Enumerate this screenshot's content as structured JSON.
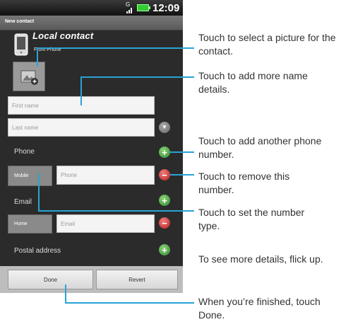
{
  "status_bar": {
    "network": "G",
    "time": "12:09"
  },
  "title_bar": {
    "title": "New contact"
  },
  "account": {
    "title": "Local contact",
    "subtitle": "From Phone",
    "icon": "phone-icon"
  },
  "photo": {
    "icon": "add-picture-icon"
  },
  "name": {
    "first_placeholder": "First name",
    "last_placeholder": "Last name"
  },
  "phone": {
    "label": "Phone",
    "type": "Mobile",
    "placeholder": "Phone"
  },
  "email": {
    "label": "Email",
    "type": "Home",
    "placeholder": "Email"
  },
  "postal": {
    "label": "Postal address"
  },
  "buttons": {
    "done": "Done",
    "revert": "Revert"
  },
  "callouts": {
    "picture": "Touch to select a picture for the contact.",
    "name_details": "Touch to add more name details.",
    "add_phone": "Touch to add another phone number.",
    "remove": "Touch to remove this number.",
    "set_type": "Touch to set the number type.",
    "more_details": "To see more details, flick up.",
    "finished_prefix": "When you’re finished, touch ",
    "finished_done": "Done",
    "finished_suffix": "."
  },
  "colors": {
    "callout_line": "#29a3d6",
    "add": "#3c9a3c",
    "remove": "#c62828"
  }
}
